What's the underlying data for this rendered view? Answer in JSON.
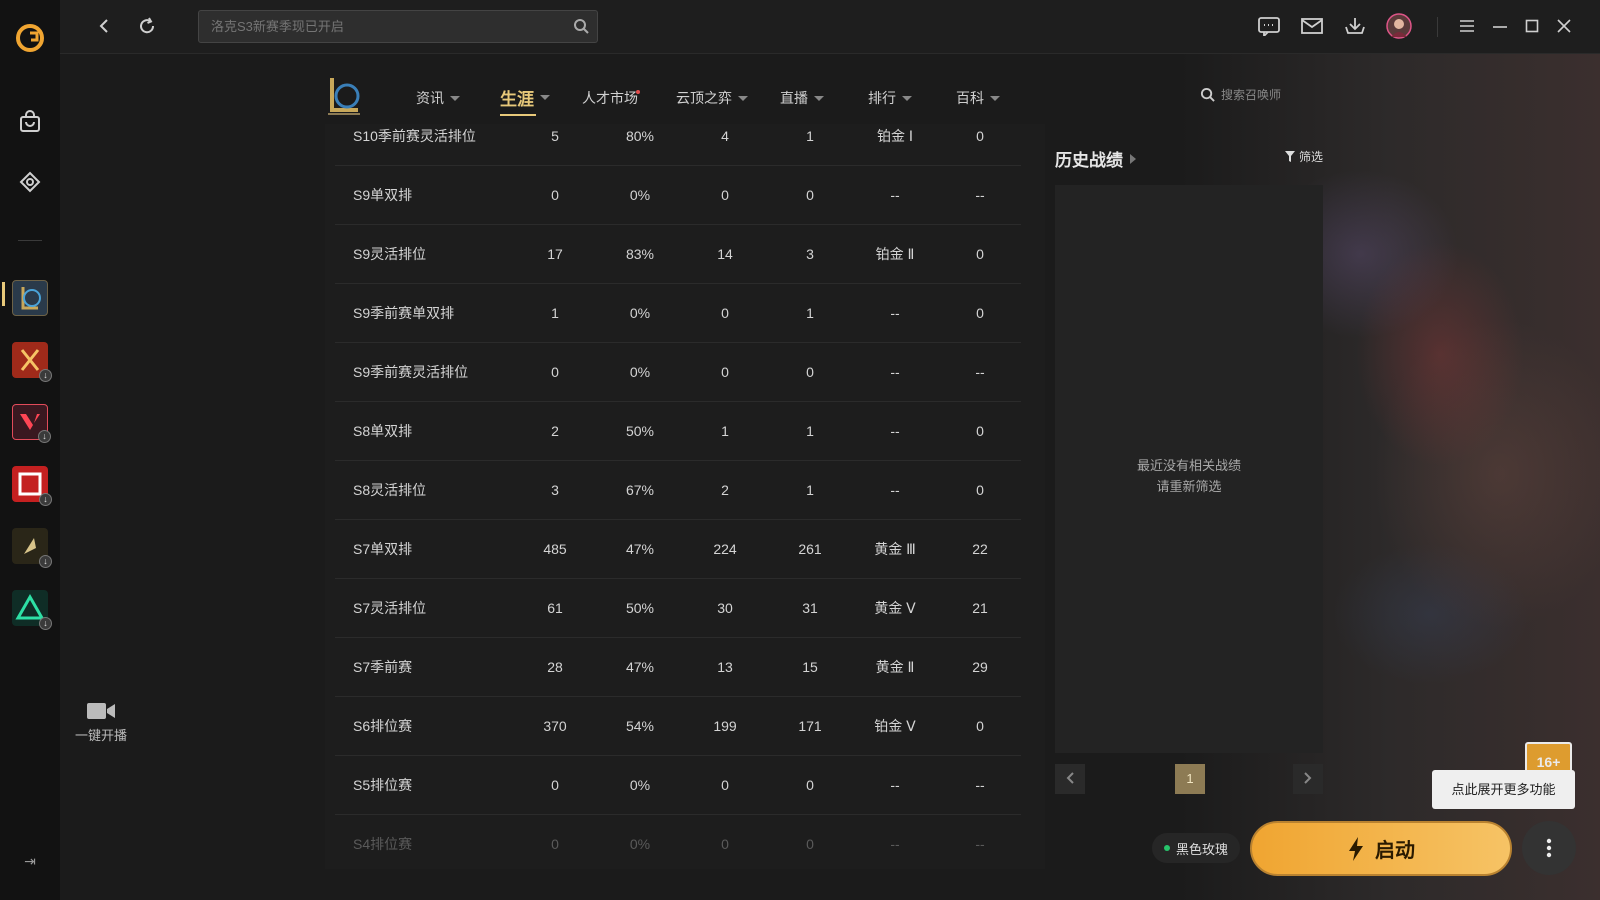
{
  "topbar": {
    "search_placeholder": "洛克S3新赛季现已开启"
  },
  "left_rail": {
    "live_label": "一键开播"
  },
  "game_nav": {
    "items": [
      {
        "label": "资讯"
      },
      {
        "label": "生涯"
      },
      {
        "label": "人才市场"
      },
      {
        "label": "云顶之弈"
      },
      {
        "label": "直播"
      },
      {
        "label": "排行"
      },
      {
        "label": "百科"
      }
    ],
    "active": "生涯",
    "summoner_search_placeholder": "搜索召唤师"
  },
  "stats_table": {
    "rows": [
      {
        "name": "S10季前赛灵活排位",
        "games": "5",
        "winrate": "80%",
        "wins": "4",
        "losses": "1",
        "rank": "铂金 Ⅰ",
        "points": "0"
      },
      {
        "name": "S9单双排",
        "games": "0",
        "winrate": "0%",
        "wins": "0",
        "losses": "0",
        "rank": "--",
        "points": "--"
      },
      {
        "name": "S9灵活排位",
        "games": "17",
        "winrate": "83%",
        "wins": "14",
        "losses": "3",
        "rank": "铂金 Ⅱ",
        "points": "0"
      },
      {
        "name": "S9季前赛单双排",
        "games": "1",
        "winrate": "0%",
        "wins": "0",
        "losses": "1",
        "rank": "--",
        "points": "0"
      },
      {
        "name": "S9季前赛灵活排位",
        "games": "0",
        "winrate": "0%",
        "wins": "0",
        "losses": "0",
        "rank": "--",
        "points": "--"
      },
      {
        "name": "S8单双排",
        "games": "2",
        "winrate": "50%",
        "wins": "1",
        "losses": "1",
        "rank": "--",
        "points": "0"
      },
      {
        "name": "S8灵活排位",
        "games": "3",
        "winrate": "67%",
        "wins": "2",
        "losses": "1",
        "rank": "--",
        "points": "0"
      },
      {
        "name": "S7单双排",
        "games": "485",
        "winrate": "47%",
        "wins": "224",
        "losses": "261",
        "rank": "黄金 Ⅲ",
        "points": "22"
      },
      {
        "name": "S7灵活排位",
        "games": "61",
        "winrate": "50%",
        "wins": "30",
        "losses": "31",
        "rank": "黄金 Ⅴ",
        "points": "21"
      },
      {
        "name": "S7季前赛",
        "games": "28",
        "winrate": "47%",
        "wins": "13",
        "losses": "15",
        "rank": "黄金 Ⅱ",
        "points": "29"
      },
      {
        "name": "S6排位赛",
        "games": "370",
        "winrate": "54%",
        "wins": "199",
        "losses": "171",
        "rank": "铂金 Ⅴ",
        "points": "0"
      },
      {
        "name": "S5排位赛",
        "games": "0",
        "winrate": "0%",
        "wins": "0",
        "losses": "0",
        "rank": "--",
        "points": "--"
      },
      {
        "name": "S4排位赛",
        "games": "0",
        "winrate": "0%",
        "wins": "0",
        "losses": "0",
        "rank": "--",
        "points": "--"
      }
    ]
  },
  "history": {
    "title": "历史战绩",
    "filter_label": "筛选",
    "empty_line1": "最近没有相关战绩",
    "empty_line2": "请重新筛选",
    "page": "1"
  },
  "bottom": {
    "age_badge": "16+",
    "tooltip": "点此展开更多功能",
    "account_label": "黑色玫瑰",
    "launch_label": "启动"
  },
  "colors": {
    "accent_gold": "#e8c97a",
    "launch_orange": "#f0a531",
    "status_green": "#27c46b"
  }
}
